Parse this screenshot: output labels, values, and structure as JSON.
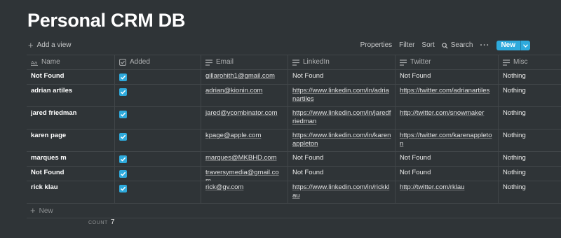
{
  "title": "Personal CRM DB",
  "toolbar": {
    "add_view": "Add a view",
    "properties": "Properties",
    "filter": "Filter",
    "sort": "Sort",
    "search": "Search",
    "more": "···",
    "new": "New"
  },
  "columns": {
    "name": "Name",
    "added": "Added",
    "email": "Email",
    "linkedin": "LinkedIn",
    "twitter": "Twitter",
    "misc": "Misc"
  },
  "rows": [
    {
      "name": "Not Found",
      "added": true,
      "email": "gillarohith1@gmail.com",
      "linkedin": "Not Found",
      "twitter": "Not Found",
      "misc": "Nothing"
    },
    {
      "name": "adrian artiles",
      "added": true,
      "email": "adrian@kionin.com",
      "linkedin": "https://www.linkedin.com/in/adrianartiles",
      "twitter": "https://twitter.com/adrianartiles",
      "misc": "Nothing"
    },
    {
      "name": "jared friedman",
      "added": true,
      "email": "jared@ycombinator.com",
      "linkedin": "https://www.linkedin.com/in/jaredfriedman",
      "twitter": "http://twitter.com/snowmaker",
      "misc": "Nothing"
    },
    {
      "name": "karen page",
      "added": true,
      "email": "kpage@apple.com",
      "linkedin": "https://www.linkedin.com/in/karenappleton",
      "twitter": "https://twitter.com/karenappleton",
      "misc": "Nothing"
    },
    {
      "name": "marques m",
      "added": true,
      "email": "marques@MKBHD.com",
      "linkedin": "Not Found",
      "twitter": "Not Found",
      "misc": "Nothing"
    },
    {
      "name": "Not Found",
      "added": true,
      "email": "traversymedia@gmail.com",
      "linkedin": "Not Found",
      "twitter": "Not Found",
      "misc": "Nothing"
    },
    {
      "name": "rick klau",
      "added": true,
      "email": "rick@gv.com",
      "linkedin": "https://www.linkedin.com/in/rickklau",
      "twitter": "http://twitter.com/rklau",
      "misc": "Nothing"
    }
  ],
  "new_row": "New",
  "footer": {
    "count_label": "COUNT",
    "count_value": "7"
  }
}
